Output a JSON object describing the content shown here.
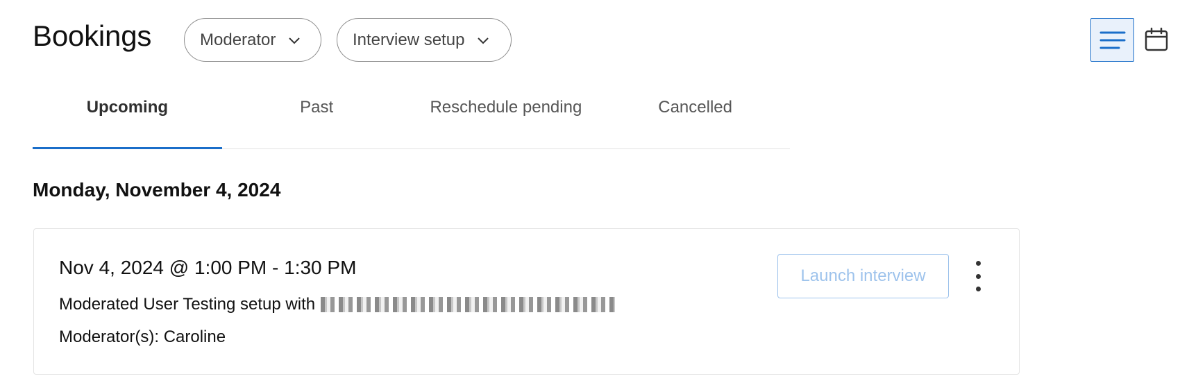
{
  "header": {
    "title": "Bookings",
    "filters": [
      {
        "label": "Moderator"
      },
      {
        "label": "Interview setup"
      }
    ],
    "view_toggle": {
      "list_icon": "list-icon",
      "calendar_icon": "calendar-icon",
      "active": "list"
    }
  },
  "tabs": [
    {
      "label": "Upcoming",
      "active": true
    },
    {
      "label": "Past",
      "active": false
    },
    {
      "label": "Reschedule pending",
      "active": false
    },
    {
      "label": "Cancelled",
      "active": false
    }
  ],
  "date_group": {
    "heading": "Monday, November 4, 2024"
  },
  "booking": {
    "time": "Nov 4, 2024 @ 1:00 PM - 1:30 PM",
    "setup_prefix": "Moderated User Testing setup with",
    "moderator": "Moderator(s): Caroline",
    "launch_label": "Launch interview",
    "more_icon": "more-vertical-icon"
  },
  "colors": {
    "accent": "#1a6ec9",
    "accent_light_bg": "#e9f1fb",
    "disabled_button": "#9ec3ec",
    "border": "#e3e3e3"
  }
}
